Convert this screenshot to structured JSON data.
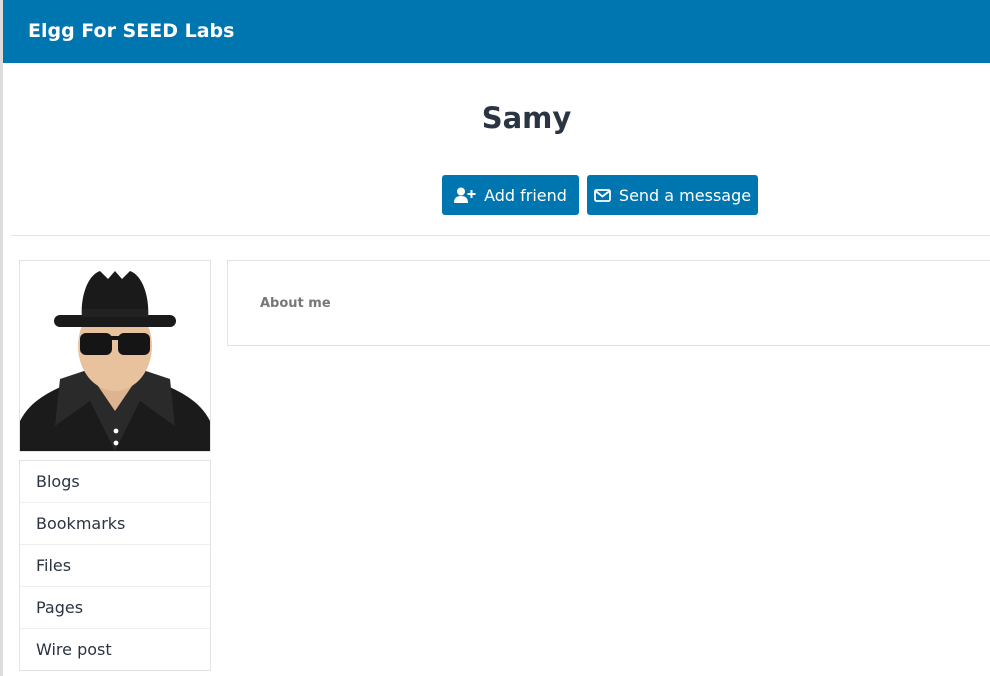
{
  "header": {
    "site_name": "Elgg For SEED Labs"
  },
  "profile": {
    "name": "Samy",
    "add_friend_label": "Add friend",
    "send_message_label": "Send a message",
    "about_label": "About me"
  },
  "sidebar": {
    "items": [
      {
        "label": "Blogs"
      },
      {
        "label": "Bookmarks"
      },
      {
        "label": "Files"
      },
      {
        "label": "Pages"
      },
      {
        "label": "Wire post"
      }
    ]
  },
  "colors": {
    "topbar": "#0076b0",
    "button": "#0076b0"
  }
}
